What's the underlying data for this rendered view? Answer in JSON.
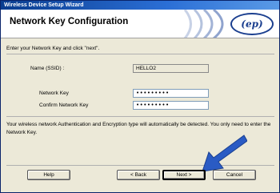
{
  "window": {
    "title": "Wireless Device Setup Wizard"
  },
  "header": {
    "title": "Network Key Configuration",
    "logo_text": "(ep)"
  },
  "instruction": "Enter your Network Key and click \"next\".",
  "form": {
    "ssid_label": "Name (SSID) :",
    "ssid_value": "HELLO2",
    "network_key_label": "Network Key",
    "network_key_value": "•••••••••",
    "confirm_key_label": "Confirm Network Key",
    "confirm_key_value": "•••••••••"
  },
  "description": "Your wireless network Authentication and Encryption type will automatically be detected. You only need to enter the Network Key.",
  "buttons": {
    "help": "Help",
    "back": "< Back",
    "next": "Next >",
    "cancel": "Cancel"
  },
  "colors": {
    "titlebar": "#0a3d8f",
    "arrow": "#2a5bc4",
    "logo": "#1b3f8f"
  }
}
